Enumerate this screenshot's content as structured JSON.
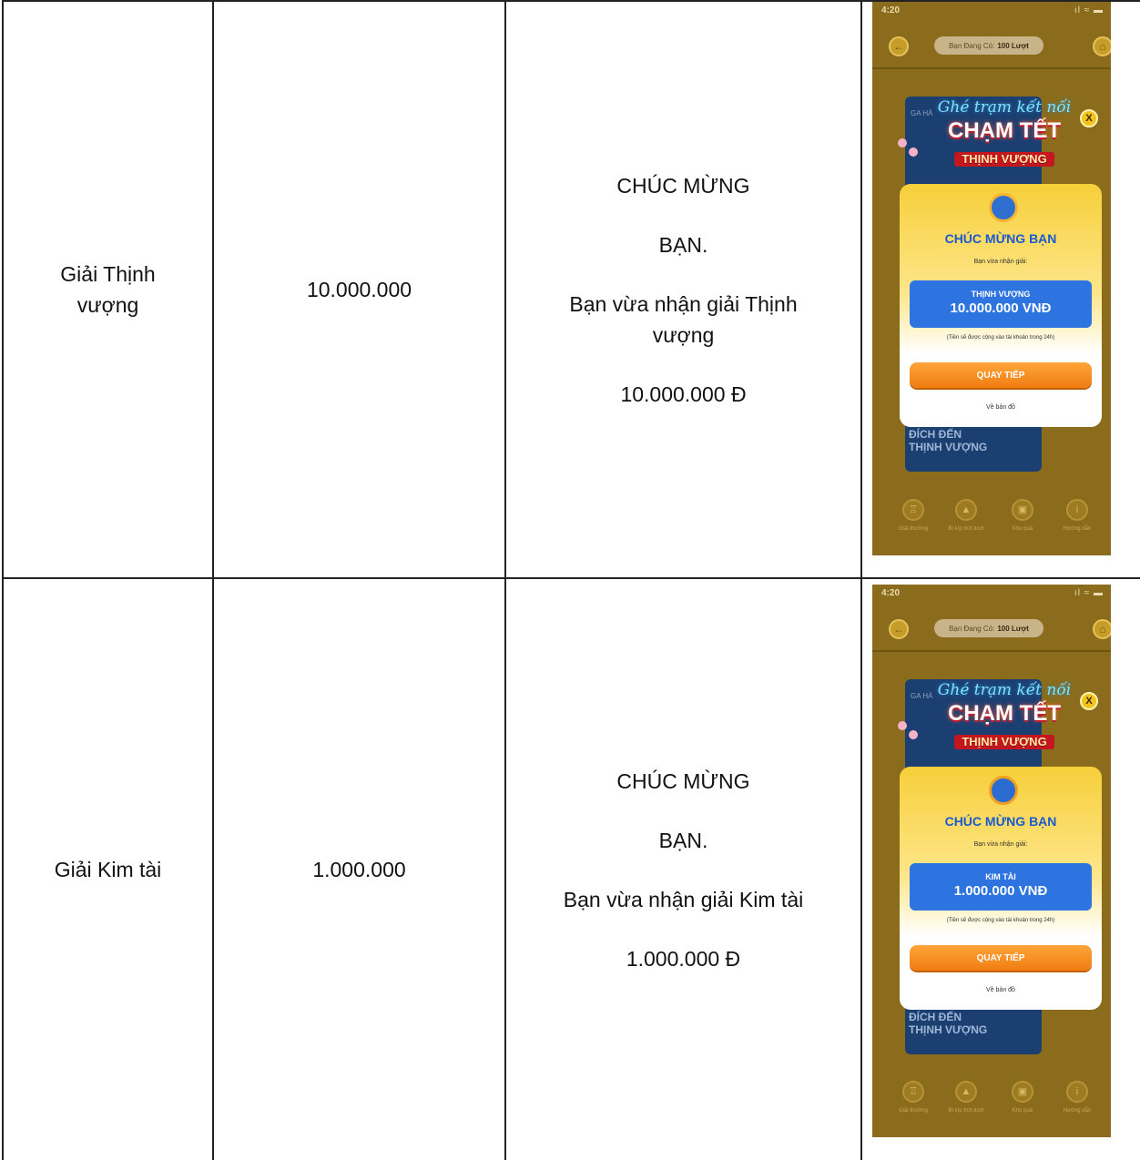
{
  "rows": [
    {
      "prize_name": "Giải Thịnh vượng",
      "amount": "10.000.000",
      "message": [
        "CHÚC MỪNG",
        "BẠN.",
        "Bạn vừa nhận giải Thịnh vượng",
        "10.000.000 Đ"
      ],
      "screen": {
        "time": "4:20",
        "status_icons": "ıl ≈ ▬",
        "turns_label": "Bạn Đang Có:",
        "turns_value": "100 Lượt",
        "ga_label": "GA HÀ",
        "bg_title": [
          "ĐÍCH ĐẾN",
          "THỊNH VƯỢNG"
        ],
        "banner_script": "Ghé trạm kết nối",
        "banner_title": "CHẠM TẾT",
        "banner_sub": "THỊNH VƯỢNG",
        "close": "X",
        "congrats": "CHÚC MỪNG BẠN",
        "received": "Bạn vừa nhận giải:",
        "prize_label": "THỊNH VƯỢNG",
        "prize_value": "10.000.000 VNĐ",
        "note": "(Tiền sẽ được cộng vào tài khoản trong 24h)",
        "spin_button": "QUAY TIẾP",
        "map_link": "Về bản đồ",
        "nav": [
          "Giải thưởng",
          "Bí kíp tích lượt",
          "Kho quà",
          "Hướng dẫn"
        ],
        "nav_icons": [
          "trophy-icon",
          "gift-tips-icon",
          "gift-box-icon",
          "info-icon"
        ]
      }
    },
    {
      "prize_name": "Giải Kim tài",
      "amount": "1.000.000",
      "message": [
        "CHÚC MỪNG",
        "BẠN.",
        "Bạn vừa nhận giải Kim tài",
        "1.000.000 Đ"
      ],
      "screen": {
        "time": "4:20",
        "status_icons": "ıl ≈ ▬",
        "turns_label": "Bạn Đang Có:",
        "turns_value": "100 Lượt",
        "ga_label": "GA HÀ",
        "bg_title": [
          "ĐÍCH ĐẾN",
          "THỊNH VƯỢNG"
        ],
        "banner_script": "Ghé trạm kết nối",
        "banner_title": "CHẠM TẾT",
        "banner_sub": "THỊNH VƯỢNG",
        "close": "X",
        "congrats": "CHÚC MỪNG BẠN",
        "received": "Bạn vừa nhận giải:",
        "prize_label": "KIM TÀI",
        "prize_value": "1.000.000 VNĐ",
        "note": "(Tiền sẽ được cộng vào tài khoản trong 24h)",
        "spin_button": "QUAY TIẾP",
        "map_link": "Về bản đồ",
        "nav": [
          "Giải thưởng",
          "Bí kíp tích lượt",
          "Kho quà",
          "Hướng dẫn"
        ],
        "nav_icons": [
          "trophy-icon",
          "gift-tips-icon",
          "gift-box-icon",
          "info-icon"
        ]
      }
    }
  ]
}
